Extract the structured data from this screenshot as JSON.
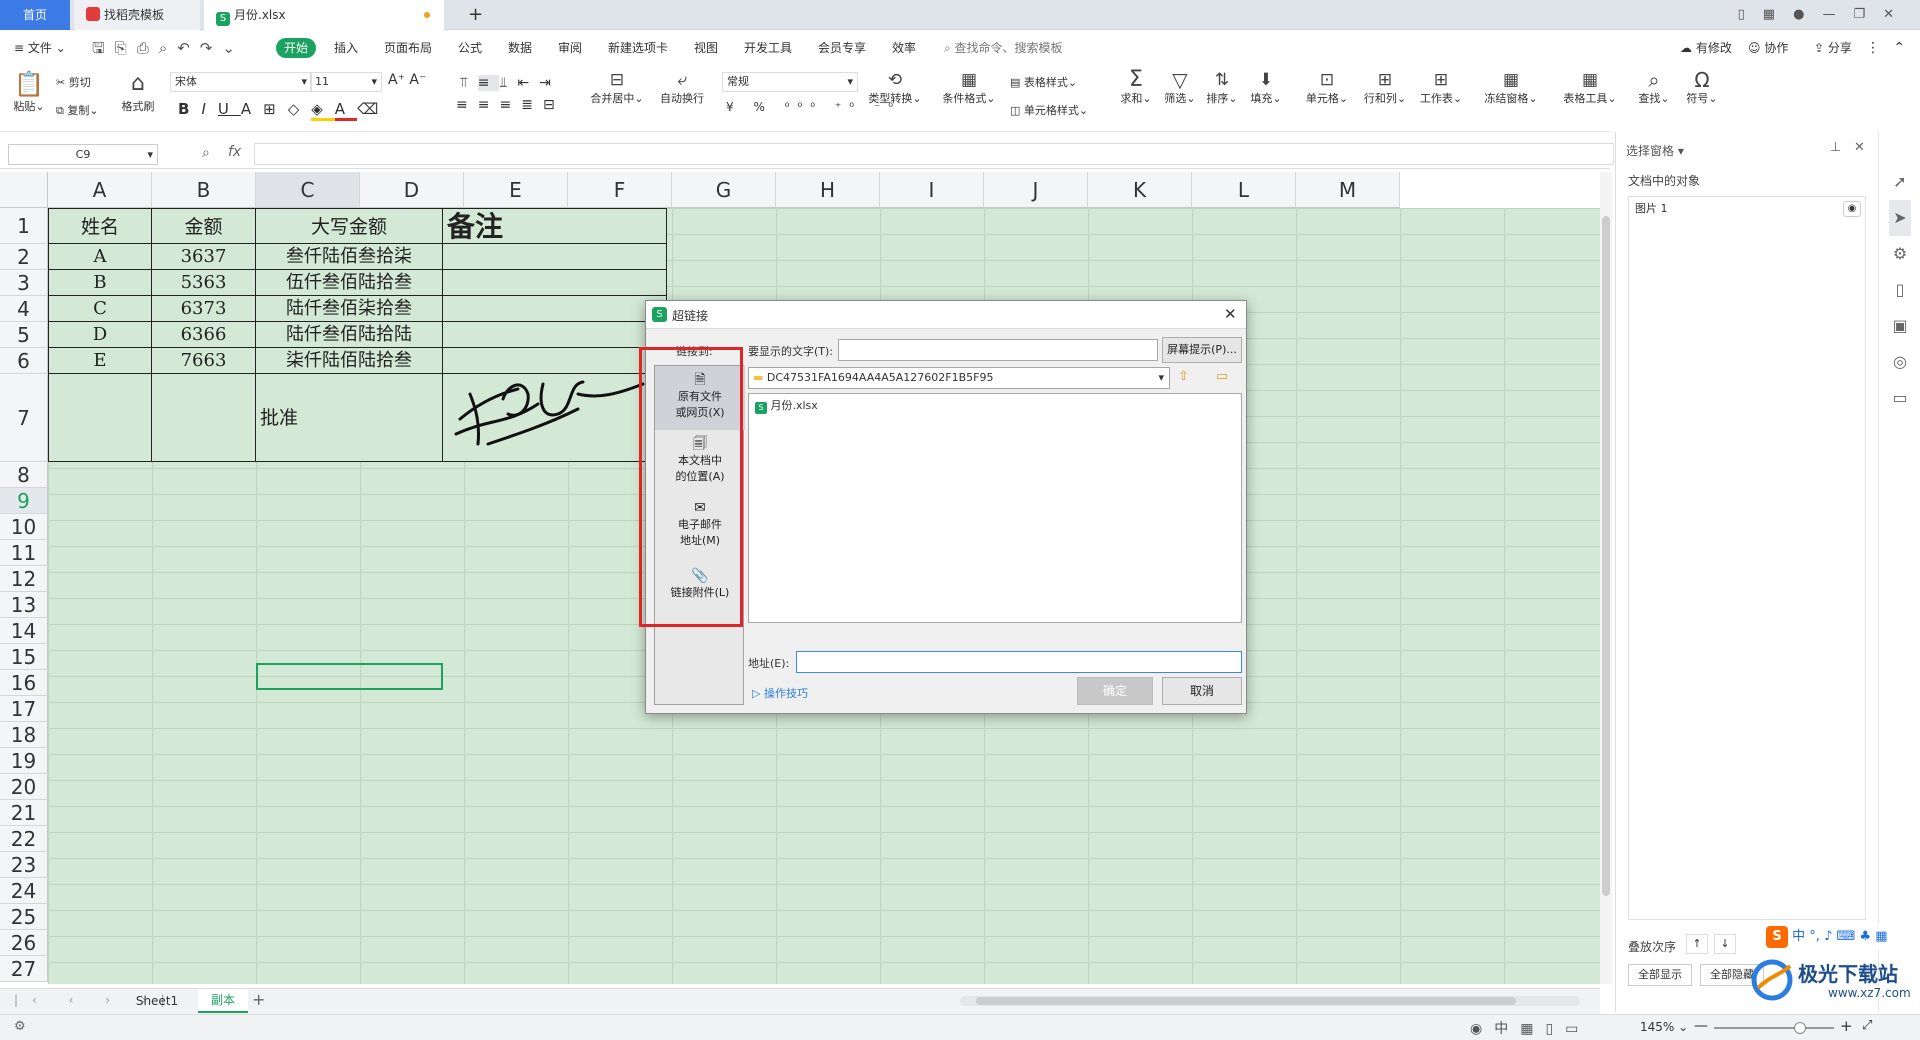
{
  "tabs": {
    "home": "首页",
    "template": "找稻壳模板",
    "file": "月份.xlsx",
    "new_tab": "+"
  },
  "menu": {
    "file": "文件",
    "start": "开始",
    "items": [
      "插入",
      "页面布局",
      "公式",
      "数据",
      "审阅",
      "新建选项卡",
      "视图",
      "开发工具",
      "会员专享",
      "效率"
    ],
    "search": "查找命令、搜索模板",
    "right": [
      "有修改",
      "协作",
      "分享"
    ]
  },
  "ribbon": {
    "paste": "粘贴",
    "cut": "剪切",
    "copy": "复制",
    "format_painter": "格式刷",
    "font": "宋体",
    "size": "11",
    "merge": "合并居中",
    "wrap": "自动换行",
    "num_format": "常规",
    "type_convert": "类型转换",
    "cond_format": "条件格式",
    "table_style": "表格样式",
    "cell_style": "单元格样式",
    "sum": "求和",
    "filter": "筛选",
    "sort": "排序",
    "fill": "填充",
    "cell": "单元格",
    "rowcol": "行和列",
    "worksheet": "工作表",
    "freeze": "冻结窗格",
    "tabletools": "表格工具",
    "find": "查找",
    "symbol": "符号"
  },
  "formula_bar": {
    "name_box": "C9",
    "fx": "fx"
  },
  "columns": [
    "A",
    "B",
    "C",
    "D",
    "E",
    "F",
    "G",
    "H",
    "I",
    "J",
    "K",
    "L",
    "M"
  ],
  "rows": [
    "1",
    "2",
    "3",
    "4",
    "5",
    "6",
    "7",
    "8",
    "9",
    "10",
    "11",
    "12",
    "13",
    "14",
    "15",
    "16",
    "17",
    "18",
    "19",
    "20",
    "21",
    "22",
    "23",
    "24",
    "25",
    "26",
    "27"
  ],
  "table": {
    "headers": [
      "姓名",
      "金额",
      "大写金额",
      "备注"
    ],
    "rows": [
      [
        "A",
        "3637",
        "叁仟陆佰叁拾柒"
      ],
      [
        "B",
        "5363",
        "伍仟叁佰陆拾叁"
      ],
      [
        "C",
        "6373",
        "陆仟叁佰柒拾叁"
      ],
      [
        "D",
        "6366",
        "陆仟叁佰陆拾陆"
      ],
      [
        "E",
        "7663",
        "柒仟陆佰陆拾叁"
      ]
    ],
    "approve": "批准"
  },
  "dialog": {
    "title": "超链接",
    "link_to": "链接到:",
    "display_text_label": "要显示的文字(T):",
    "display_text_value": "",
    "screentip": "屏幕提示(P)...",
    "folder": "DC47531FA1694AA4A5A127602F1B5F95",
    "files": [
      "月份.xlsx"
    ],
    "nav": [
      {
        "l1": "原有文件",
        "l2": "或网页(X)"
      },
      {
        "l1": "本文档中",
        "l2": "的位置(A)"
      },
      {
        "l1": "电子邮件",
        "l2": "地址(M)"
      },
      {
        "l1": "链接附件(L)",
        "l2": ""
      }
    ],
    "address_label": "地址(E):",
    "address_value": "",
    "tips": "操作技巧",
    "ok": "确定",
    "cancel": "取消"
  },
  "pane": {
    "title": "选择窗格",
    "objects_label": "文档中的对象",
    "objects": [
      "图片 1"
    ],
    "order_label": "叠放次序",
    "show_all": "全部显示",
    "hide_all": "全部隐藏"
  },
  "sheets": [
    "Sheet1",
    "副本"
  ],
  "status": {
    "zoom": "145%",
    "ime": "中"
  },
  "watermark": "极光下载站",
  "watermark_url": "www.xz7.com",
  "colors": {
    "accent": "#1aa260",
    "grid_bg": "#d3e9d5",
    "highlight": "#e0252a"
  }
}
